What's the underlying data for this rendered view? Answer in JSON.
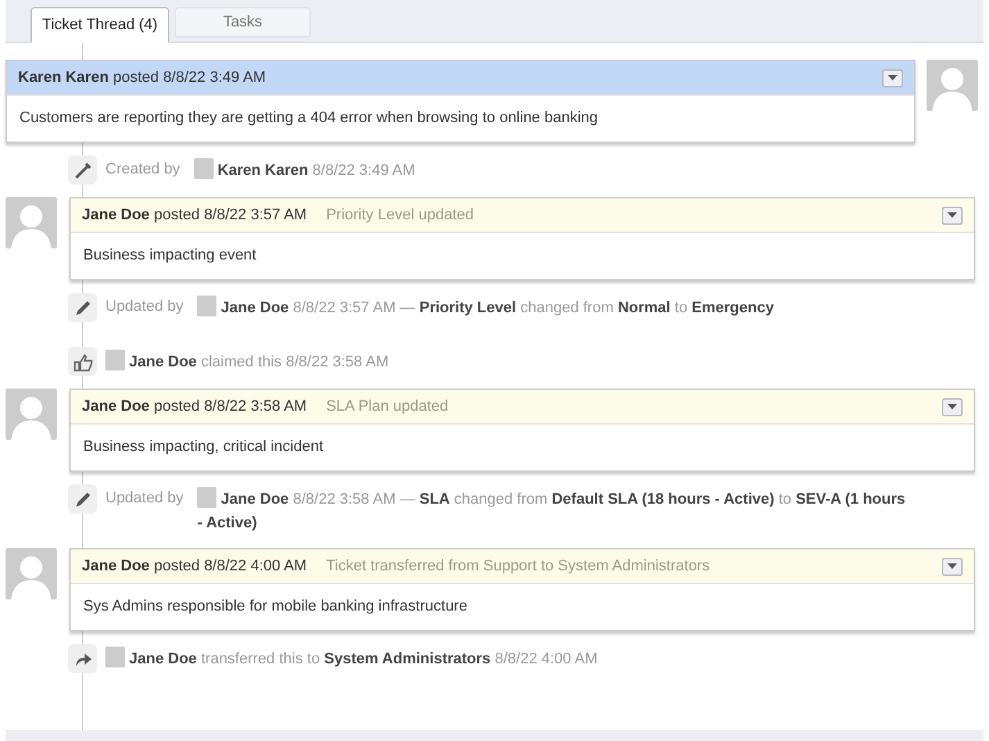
{
  "tabs": [
    {
      "label": "Ticket Thread (4)",
      "selected": true
    },
    {
      "label": "Tasks",
      "selected": false
    }
  ],
  "thread": [
    {
      "kind": "user_message",
      "author": "Karen Karen",
      "posted": "posted 8/8/22 3:49 AM",
      "body": "Customers are reporting they are getting a 404 error when browsing to online banking"
    },
    {
      "kind": "created_event",
      "prefix": "Created by",
      "text": "**Karen Karen** 8/8/22 3:49 AM"
    },
    {
      "kind": "staff_message",
      "author": "Jane Doe",
      "posted": "posted 8/8/22 3:57 AM",
      "note": "Priority Level updated",
      "body": "Business impacting event"
    },
    {
      "kind": "edited_event",
      "prefix": "Updated by",
      "text": "**Jane Doe** 8/8/22 3:57 AM — **Priority Level** changed from **Normal** to **Emergency**"
    },
    {
      "kind": "claimed_event",
      "text": "**Jane Doe** claimed this 8/8/22 3:58 AM"
    },
    {
      "kind": "staff_message",
      "author": "Jane Doe",
      "posted": "posted 8/8/22 3:58 AM",
      "note": "SLA Plan updated",
      "body": "Business impacting, critical incident"
    },
    {
      "kind": "edited_event",
      "prefix": "Updated by",
      "text": "**Jane Doe** 8/8/22 3:58 AM — **SLA** changed from **Default SLA (18 hours - Active)** to **SEV-A (1 hours - Active)**"
    },
    {
      "kind": "staff_message",
      "author": "Jane Doe",
      "posted": "posted 8/8/22 4:00 AM",
      "note": "Ticket transferred from Support to System Administrators",
      "body": "Sys Admins responsible for mobile banking infrastructure"
    },
    {
      "kind": "transferred_event",
      "text": "**Jane Doe** transferred this to **System Administrators** 8/8/22 4:00 AM"
    }
  ]
}
